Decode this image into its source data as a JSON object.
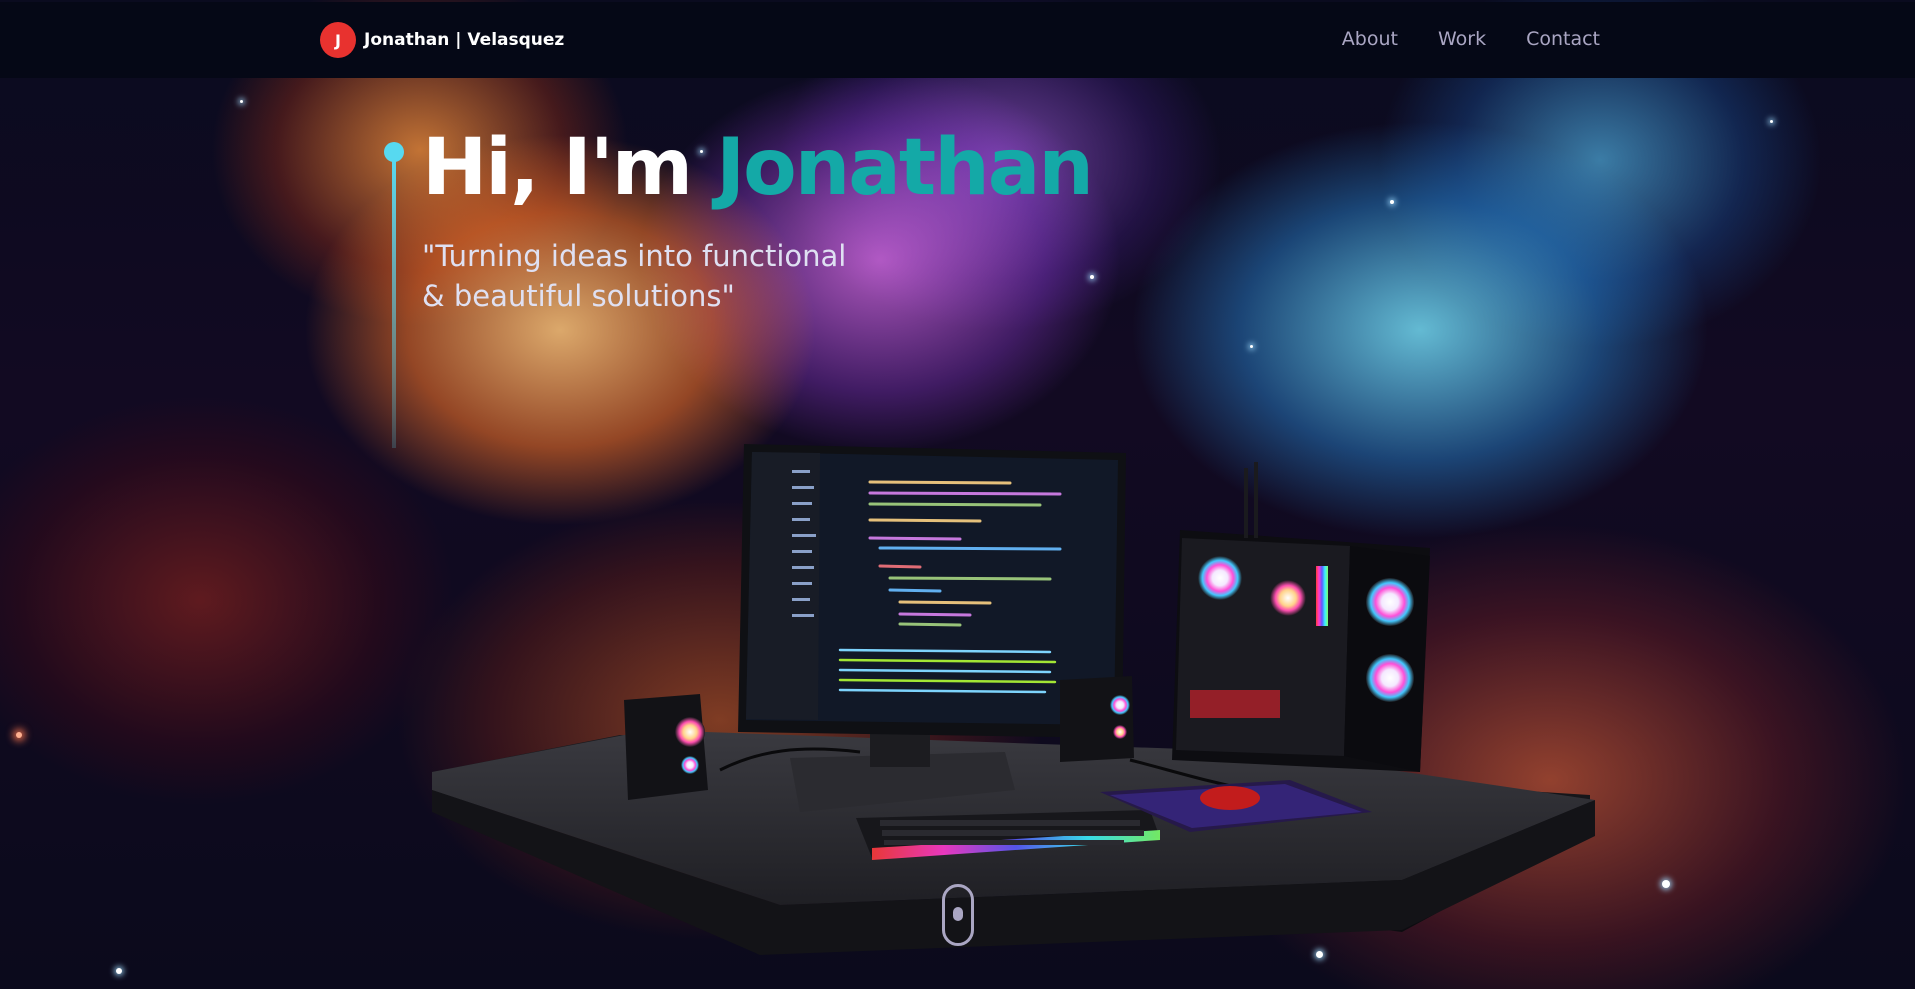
{
  "nav": {
    "logo_letter": "J",
    "brand_first": "Jonathan",
    "brand_rest": " | Velasquez",
    "links": [
      "About",
      "Work",
      "Contact"
    ]
  },
  "hero": {
    "greeting": "Hi, I'm ",
    "name": "Jonathan",
    "tagline_line1": "\"Turning ideas into functional",
    "tagline_line2": "& beautiful solutions\""
  },
  "colors": {
    "accent": "#14a9a7",
    "line_accent": "#57d9f0",
    "logo_bg": "#e8322f",
    "nav_bg": "#050816",
    "nav_text": "#aaa6c3"
  },
  "icons": {
    "scroll": "mouse-scroll-icon",
    "logo": "j-logo-icon"
  }
}
